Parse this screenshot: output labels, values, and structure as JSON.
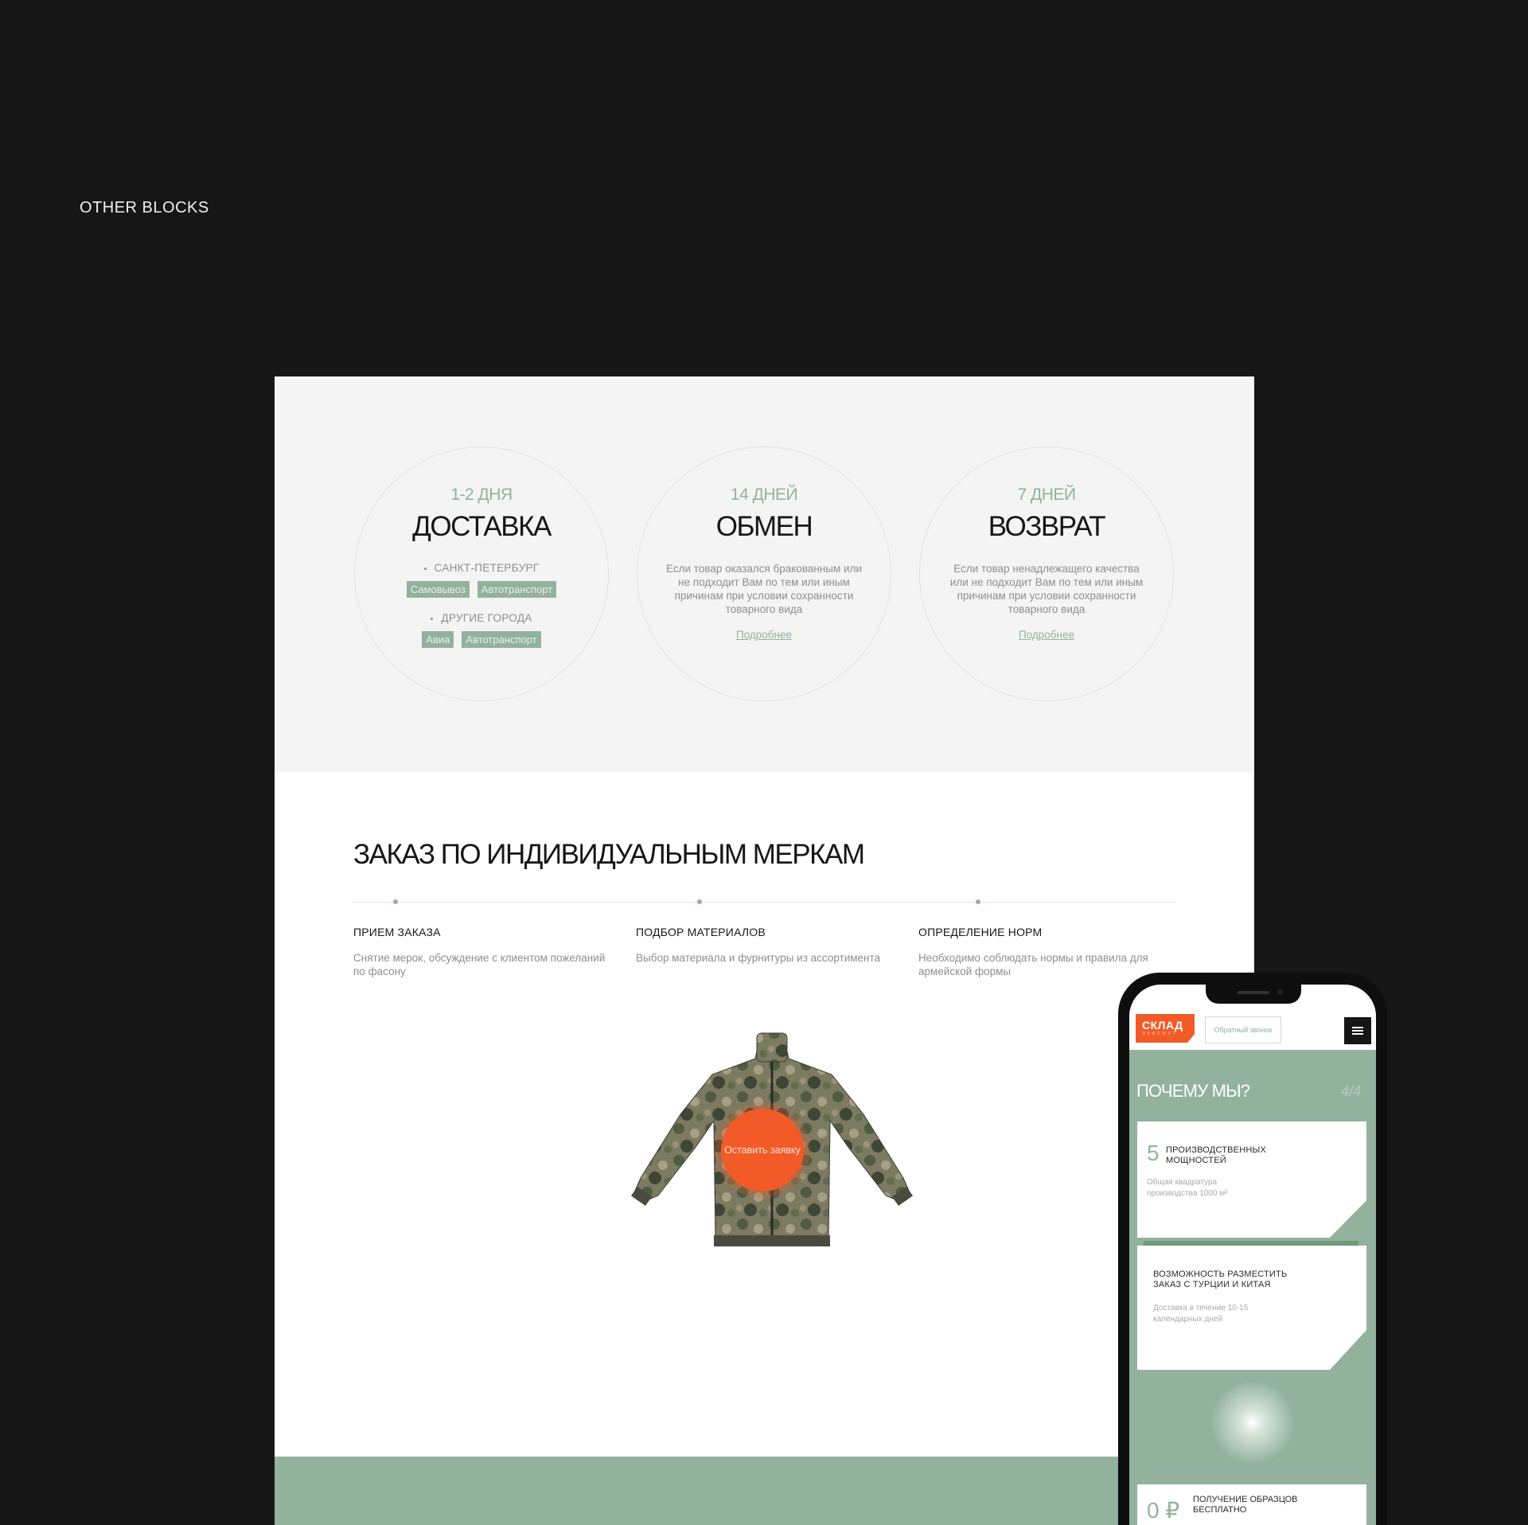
{
  "page": {
    "section_label": "OTHER BLOCKS"
  },
  "terms": {
    "delivery": {
      "days": "1-2 ДНЯ",
      "title": "ДОСТАВКА",
      "city1": "САНКТ-ПЕТЕРБУРГ",
      "city1_options": [
        "Самовывоз",
        "Автотранспорт"
      ],
      "city2": "ДРУГИЕ ГОРОДА",
      "city2_options": [
        "Авиа",
        "Автотранспорт"
      ]
    },
    "exchange": {
      "days": "14 ДНЕЙ",
      "title": "ОБМЕН",
      "description": "Если товар оказался бракованным или не подходит Вам по тем или иным причинам при условии сохранности товарного вида",
      "more": "Подробнее"
    },
    "return": {
      "days": "7 ДНЕЙ",
      "title": "ВОЗВРАТ",
      "description": "Если товар ненадлежащего качества или не подходит Вам по тем или иным причинам при условии сохранности товарного вида",
      "more": "Подробнее"
    }
  },
  "order": {
    "title": "ЗАКАЗ ПО ИНДИВИДУАЛЬНЫМ МЕРКАМ",
    "steps": [
      {
        "title": "ПРИЕМ ЗАКАЗА",
        "description": "Снятие мерок, обсуждение с клиентом пожеланий по фасону"
      },
      {
        "title": "ПОДБОР МАТЕРИАЛОВ",
        "description": "Выбор материала и фурнитуры из ассортимента"
      },
      {
        "title": "ОПРЕДЕЛЕНИЕ НОРМ",
        "description": "Необходимо соблюдать нормы и правила для армейской формы"
      }
    ],
    "cta": "Оставить заявку"
  },
  "mobile": {
    "logo": "СКЛАД",
    "logo_sub": "ЭКИПОРТ",
    "callback": "Обратный звонок",
    "title": "ПОЧЕМУ МЫ?",
    "counter": "4/4",
    "card1": {
      "number": "5",
      "title": "ПРОИЗВОДСТВЕННЫХ МОЩНОСТЕЙ",
      "description": "Общая квадратура производства 1000 м²"
    },
    "card2": {
      "title": "ВОЗМОЖНОСТЬ РАЗМЕСТИТЬ ЗАКАЗ С ТУРЦИИ И КИТАЯ",
      "description": "Доставка в течение 10-15 календарных дней"
    },
    "card3": {
      "number": "0 ₽",
      "title": "ПОЛУЧЕНИЕ ОБРАЗЦОВ БЕСПЛАТНО"
    }
  },
  "colors": {
    "accent_green": "#93b29e",
    "accent_orange": "#f25a28",
    "background": "#161616"
  }
}
